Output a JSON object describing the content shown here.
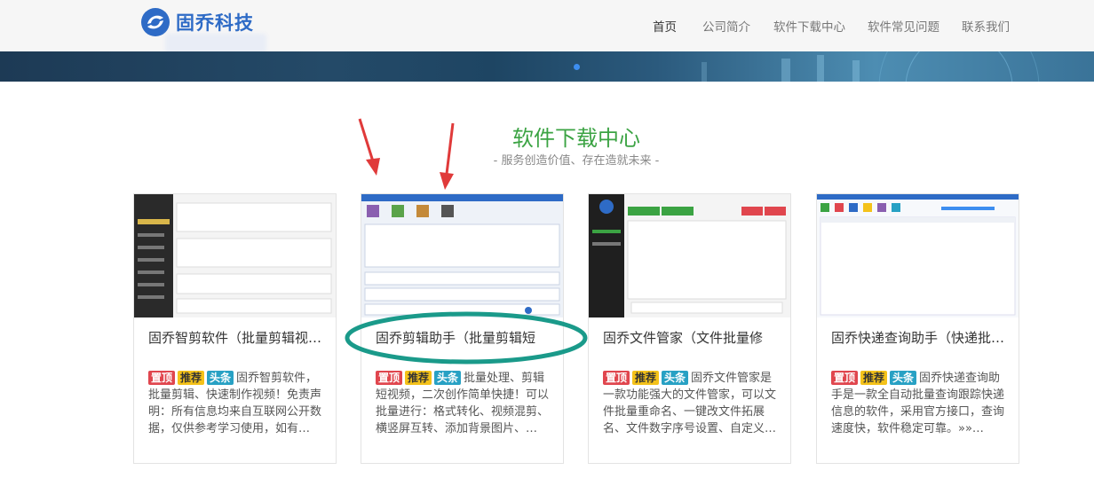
{
  "brand": {
    "name": "固乔科技"
  },
  "nav": {
    "items": [
      {
        "label": "首页",
        "active": true
      },
      {
        "label": "公司简介",
        "active": false
      },
      {
        "label": "软件下载中心",
        "active": false
      },
      {
        "label": "软件常见问题",
        "active": false
      },
      {
        "label": "联系我们",
        "active": false
      }
    ]
  },
  "section": {
    "title": "软件下载中心",
    "subtitle": "- 服务创造价值、存在造就未来 -"
  },
  "tags": {
    "top": "置顶",
    "recommend": "推荐",
    "headline": "头条"
  },
  "cards": [
    {
      "title": "固乔智剪软件（批量剪辑视…",
      "desc": "固乔智剪软件，批量剪辑、快速制作视频！免责声明：所有信息均来自互联网公开数据，仅供参考学习使用，如有…"
    },
    {
      "title": "固乔剪辑助手（批量剪辑短",
      "desc": "批量处理、剪辑短视频，二次创作简单快捷！可以批量进行：格式转化、视频混剪、横竖屏互转、添加背景图片、…"
    },
    {
      "title": "固乔文件管家（文件批量修",
      "desc": "固乔文件管家是一款功能强大的文件管家，可以文件批量重命名、一键改文件拓展名、文件数字序号设置、自定义…"
    },
    {
      "title": "固乔快递查询助手（快递批…",
      "desc": "固乔快递查询助手是一款全自动批量查询跟踪快递信息的软件，采用官方接口，查询速度快，软件稳定可靠。»»…"
    }
  ],
  "colors": {
    "accent_green": "#3ba343",
    "brand_blue": "#2e6bc6",
    "annotation_red": "#e03a3a",
    "annotation_teal": "#1a9a8a"
  }
}
